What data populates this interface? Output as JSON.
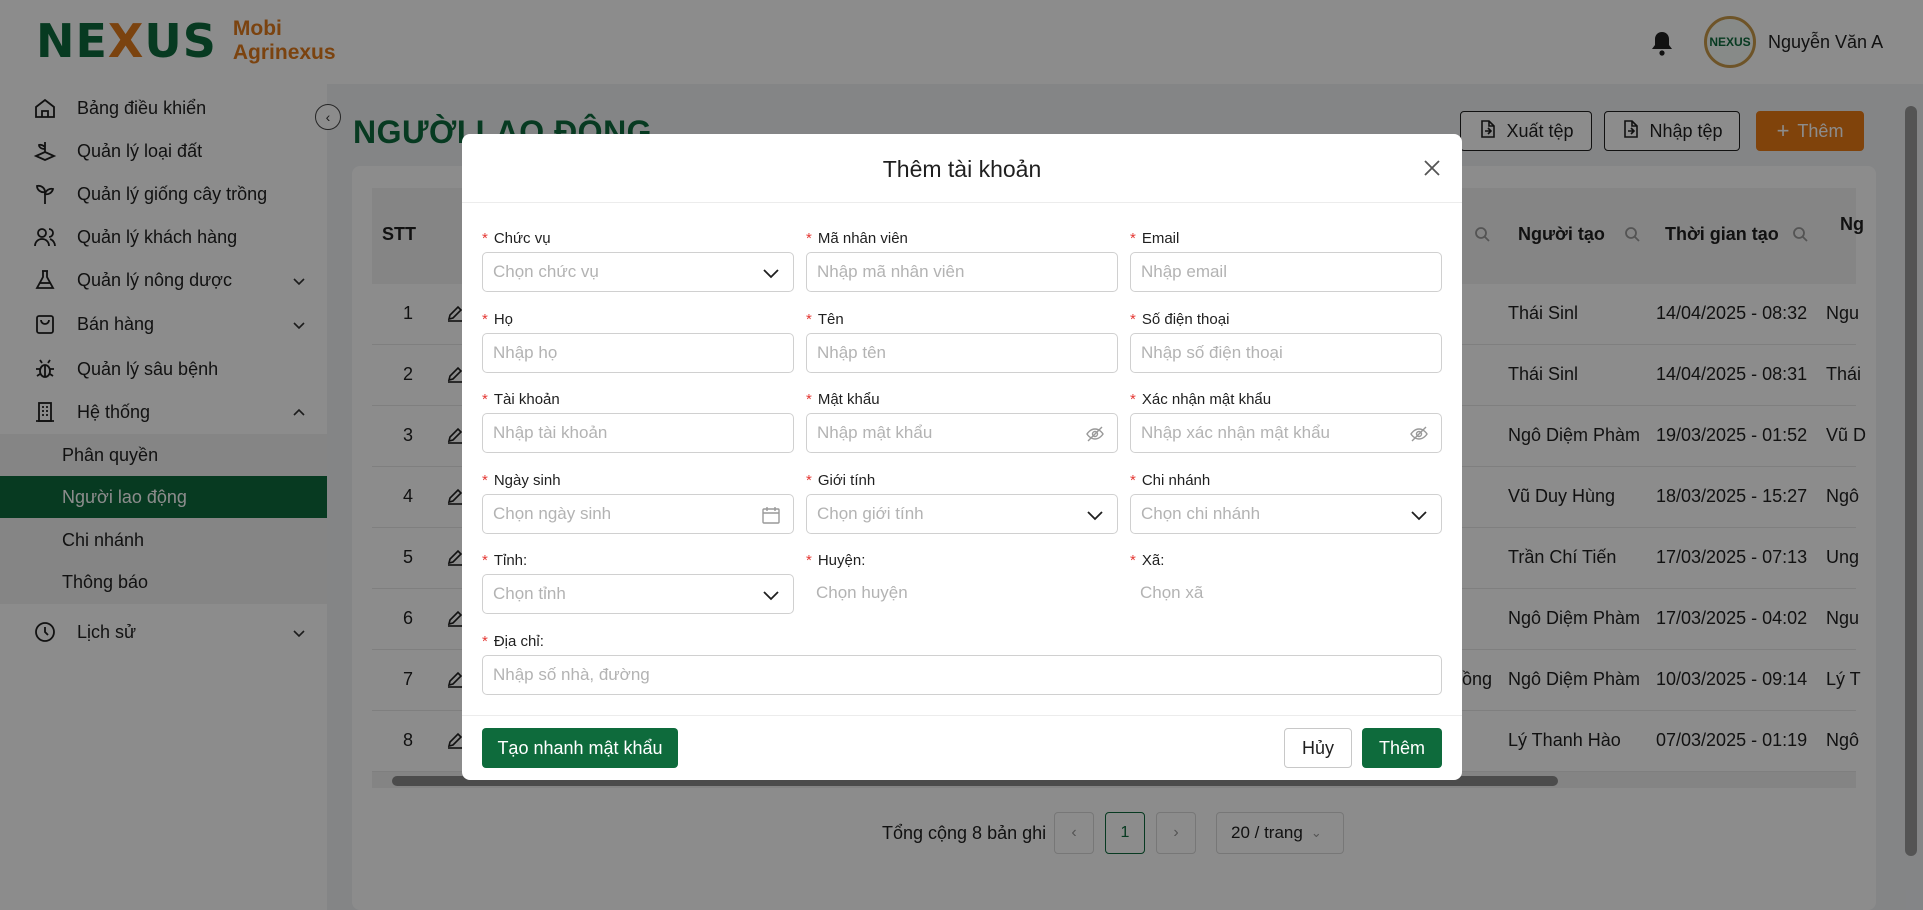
{
  "header": {
    "logo_mark_left": "NE",
    "logo_mark_x": "X",
    "logo_mark_right": "US",
    "logo_line1": "Mobi",
    "logo_line2": "Agrinexus",
    "avatar_text": "NEXUS",
    "username": "Nguyễn Văn A"
  },
  "sidebar": {
    "items": [
      {
        "label": "Bảng điều khiển",
        "icon": "home-icon"
      },
      {
        "label": "Quản lý loại đất",
        "icon": "soil-icon"
      },
      {
        "label": "Quản lý giống cây trồng",
        "icon": "plant-icon"
      },
      {
        "label": "Quản lý khách hàng",
        "icon": "users-icon"
      },
      {
        "label": "Quản lý nông dược",
        "icon": "flask-icon"
      },
      {
        "label": "Bán hàng",
        "icon": "bag-icon"
      },
      {
        "label": "Quản lý sâu bệnh",
        "icon": "bug-icon"
      },
      {
        "label": "Hệ thống",
        "icon": "building-icon"
      },
      {
        "label": "Lịch sử",
        "icon": "clock-icon"
      }
    ],
    "sub_items": [
      {
        "label": "Phân quyền"
      },
      {
        "label": "Người lao động"
      },
      {
        "label": "Chi nhánh"
      },
      {
        "label": "Thông báo"
      }
    ]
  },
  "page": {
    "title": "NGƯỜI LAO ĐỘNG",
    "export_label": "Xuất tệp",
    "import_label": "Nhập tệp",
    "add_label": "Thêm"
  },
  "table": {
    "col_stt": "STT",
    "col_creator": "Người tạo",
    "col_created_time": "Thời gian tạo",
    "col_partial": "Ng",
    "rows": [
      {
        "stt": "1",
        "creator": "Thái Sinl",
        "time": "14/04/2025 - 08:32",
        "last": "Ngu"
      },
      {
        "stt": "2",
        "creator": "Thái Sinl",
        "time": "14/04/2025 - 08:31",
        "last": "Thái"
      },
      {
        "stt": "3",
        "creator": "Ngô Diệm Phàm",
        "time": "19/03/2025 - 01:52",
        "last": "Vũ D"
      },
      {
        "stt": "4",
        "creator": "Vũ Duy Hùng",
        "time": "18/03/2025 - 15:27",
        "last": "Ngô"
      },
      {
        "stt": "5",
        "creator": "Trần Chí Tiến",
        "time": "17/03/2025 - 07:13",
        "last": "Ung"
      },
      {
        "stt": "6",
        "creator": "Ngô Diệm Phàm",
        "time": "17/03/2025 - 04:02",
        "last": "Ngu"
      },
      {
        "stt": "7",
        "creator": "Ngô Diệm Phàm",
        "time": "10/03/2025 - 09:14",
        "last": "Lý T",
        "partial_left": "ồng"
      },
      {
        "stt": "8",
        "creator": "Lý Thanh Hào",
        "time": "07/03/2025 - 01:19",
        "last": "Ngô"
      }
    ]
  },
  "pagination": {
    "total": "Tổng cộng 8 bản ghi",
    "current": "1",
    "page_size": "20 / trang"
  },
  "modal": {
    "title": "Thêm tài khoản",
    "fields": {
      "position": {
        "label": "Chức vụ",
        "placeholder": "Chọn chức vụ"
      },
      "employee_code": {
        "label": "Mã nhân viên",
        "placeholder": "Nhập mã nhân viên"
      },
      "email": {
        "label": "Email",
        "placeholder": "Nhập email"
      },
      "last_name": {
        "label": "Họ",
        "placeholder": "Nhập họ"
      },
      "first_name": {
        "label": "Tên",
        "placeholder": "Nhập tên"
      },
      "phone": {
        "label": "Số điện thoại",
        "placeholder": "Nhập số điện thoại"
      },
      "account": {
        "label": "Tài khoản",
        "placeholder": "Nhập tài khoản"
      },
      "password": {
        "label": "Mật khẩu",
        "placeholder": "Nhập mật khẩu"
      },
      "confirm_password": {
        "label": "Xác nhận mật khẩu",
        "placeholder": "Nhập xác nhận mật khẩu"
      },
      "birthday": {
        "label": "Ngày sinh",
        "placeholder": "Chọn ngày sinh"
      },
      "gender": {
        "label": "Giới tính",
        "placeholder": "Chọn giới tính"
      },
      "branch": {
        "label": "Chi nhánh",
        "placeholder": "Chọn chi nhánh"
      },
      "province": {
        "label": "Tỉnh:",
        "placeholder": "Chọn tỉnh"
      },
      "district": {
        "label": "Huyện:",
        "placeholder": "Chọn huyện"
      },
      "ward": {
        "label": "Xã:",
        "placeholder": "Chọn xã"
      },
      "address": {
        "label": "Địa chỉ:",
        "placeholder": "Nhập số nhà, đường"
      }
    },
    "generate_password_label": "Tạo nhanh mật khẩu",
    "cancel_label": "Hủy",
    "submit_label": "Thêm"
  },
  "colors": {
    "brand_green": "#0e6b3c",
    "brand_orange": "#ea7a15",
    "required_red": "#e53935"
  }
}
